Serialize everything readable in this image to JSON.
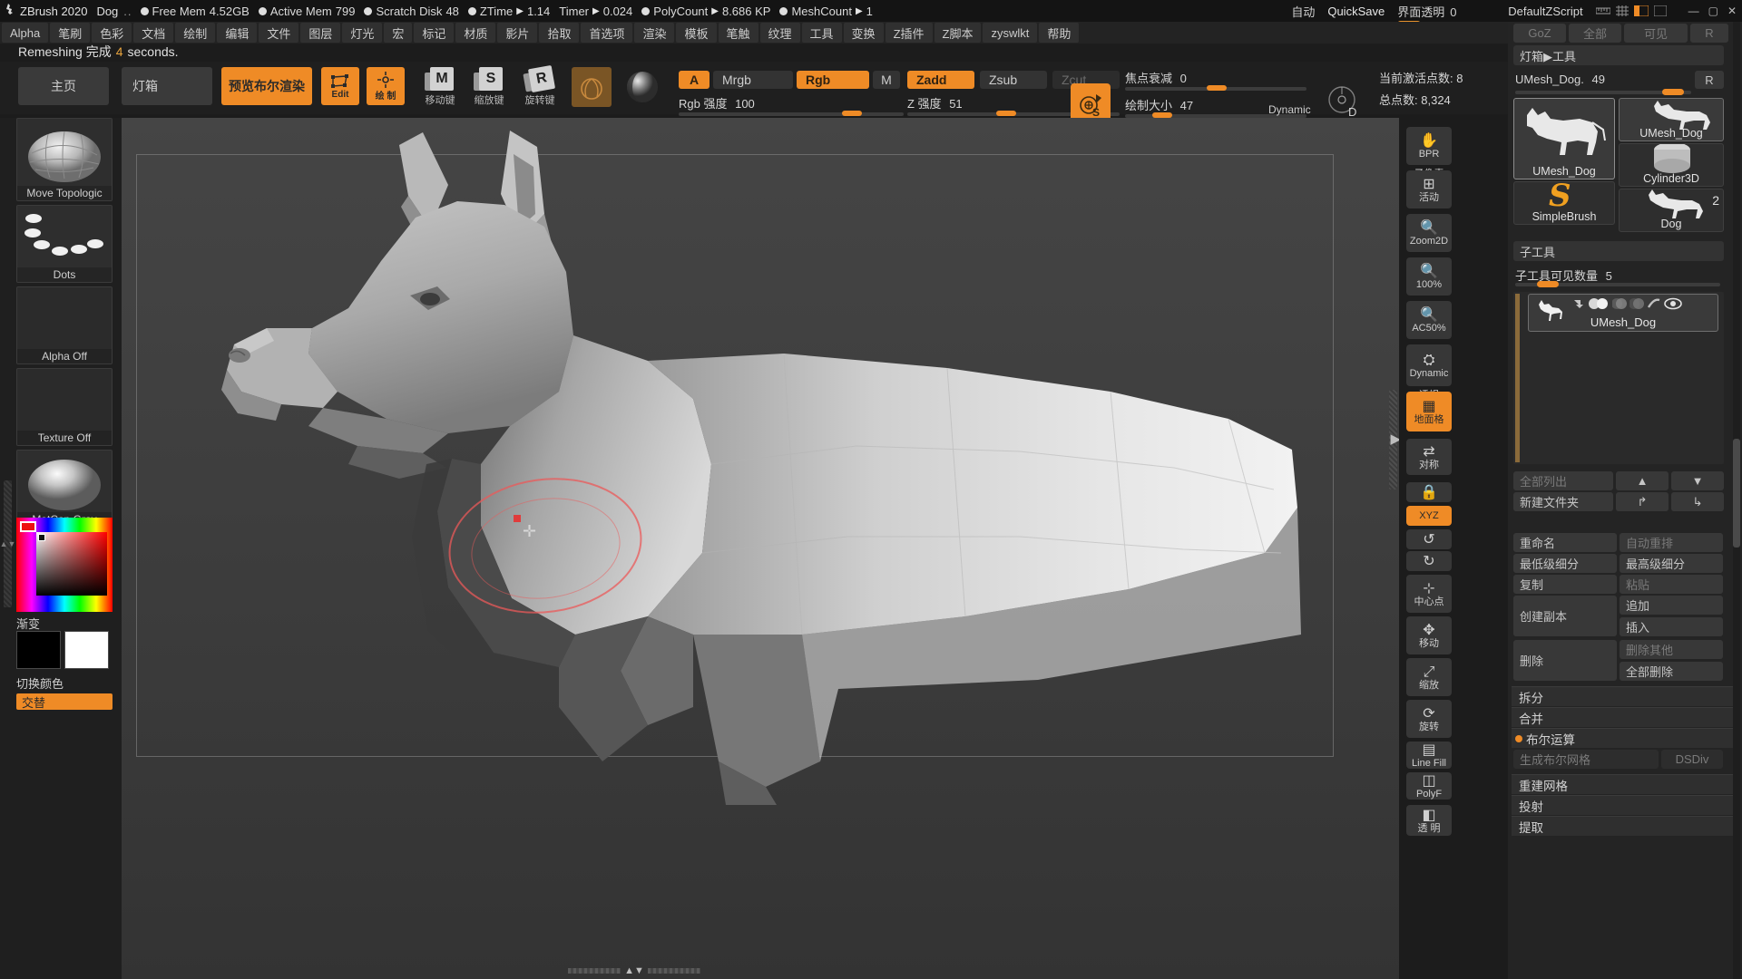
{
  "titlebar": {
    "logo_icon": "zbrush-logo-icon",
    "app_name": "ZBrush 2020",
    "document_name": "Dog",
    "ellipsis": "..",
    "stats": [
      {
        "label": "Free Mem",
        "value": "4.52GB"
      },
      {
        "label": "Active Mem",
        "value": "799"
      },
      {
        "label": "Scratch Disk",
        "value": "48"
      },
      {
        "label": "ZTime",
        "value": "1.14",
        "arrow": true
      },
      {
        "label": "Timer",
        "value": "0.024",
        "arrow": true
      },
      {
        "label": "PolyCount",
        "value": "8.686 KP",
        "arrow": true
      },
      {
        "label": "MeshCount",
        "value": "1",
        "arrow": true
      }
    ],
    "auto_label": "自动",
    "quicksave_label": "QuickSave",
    "transparency_label": "界面透明",
    "transparency_value": "0",
    "zscript_label": "DefaultZScript",
    "win_minimize": "—",
    "win_maximize": "▢",
    "win_close": "✕"
  },
  "menubar": {
    "items": [
      "Alpha",
      "笔刷",
      "色彩",
      "文档",
      "绘制",
      "编辑",
      "文件",
      "图层",
      "灯光",
      "宏",
      "标记",
      "材质",
      "影片",
      "拾取",
      "首选项",
      "渲染",
      "模板",
      "笔触",
      "纹理",
      "工具",
      "变换",
      "Z插件",
      "Z脚本",
      "zyswlkt",
      "帮助"
    ]
  },
  "status": {
    "prefix": "Remeshing 完成",
    "number": "4",
    "suffix": "seconds."
  },
  "toolbar": {
    "home_label": "主页",
    "lightbox_label": "灯箱",
    "boolean_preview_label": "预览布尔渲染",
    "edit_label": "Edit",
    "draw_label": "绘 制",
    "move_label": "移动键",
    "scale_label": "缩放键",
    "rotate_label": "旋转键",
    "move_badge": "M",
    "scale_badge": "S",
    "rotate_badge": "R",
    "brush_icon": "brush-thumbnail-icon",
    "material_icon": "material-sphere-icon",
    "mrgb_group": [
      {
        "label": "A",
        "state": "on"
      },
      {
        "label": "Mrgb",
        "state": "off"
      },
      {
        "label": "Rgb",
        "state": "on"
      },
      {
        "label": "M",
        "state": "off"
      },
      {
        "label": "Zadd",
        "state": "on"
      },
      {
        "label": "Zsub",
        "state": "off"
      },
      {
        "label": "Zcut",
        "state": "dim"
      }
    ],
    "rgb_intensity_label": "Rgb 强度",
    "rgb_intensity_value": "100",
    "z_intensity_label": "Z 强度",
    "z_intensity_value": "51",
    "focal_shift_label": "焦点衰减",
    "focal_shift_value": "0",
    "draw_size_label": "绘制大小",
    "draw_size_value": "47",
    "dynamic_label": "Dynamic",
    "dynamic_icon": "dynamic-brush-icon",
    "stroke_icon": "stroke-preview-icon",
    "d_label": "D",
    "active_points_label": "当前激活点数:",
    "active_points_value": "8",
    "total_points_label": "总点数:",
    "total_points_value": "8,324"
  },
  "sidebar": {
    "tiles": [
      {
        "name": "brush",
        "caption": "Move Topologic",
        "icon": "brush-move-topological-icon"
      },
      {
        "name": "stroke",
        "caption": "Dots",
        "icon": "stroke-dots-icon"
      },
      {
        "name": "alpha",
        "caption": "Alpha Off",
        "icon": "alpha-off-icon"
      },
      {
        "name": "texture",
        "caption": "Texture Off",
        "icon": "texture-off-icon"
      },
      {
        "name": "material",
        "caption": "MatCap Gray",
        "icon": "material-matcap-gray-icon"
      }
    ],
    "gradient_label": "渐变",
    "switch_color_label": "切换颜色",
    "alternate_label": "交替",
    "primary_color": "#000000",
    "secondary_color": "#ffffff"
  },
  "right_vbar": {
    "buttons": [
      {
        "label": "BPR",
        "sub": "子像素",
        "state": "off",
        "icon": "bpr-render-icon"
      },
      {
        "label": "活动",
        "sub": "",
        "state": "off",
        "icon": "scroll-active-icon"
      },
      {
        "label": "Zoom2D",
        "sub": "",
        "state": "off",
        "icon": "zoom-2d-icon"
      },
      {
        "label": "100%",
        "sub": "",
        "state": "off",
        "icon": "zoom-100-icon"
      },
      {
        "label": "AC50%",
        "sub": "",
        "state": "off",
        "icon": "zoom-ac50-icon"
      },
      {
        "label": "Dynamic",
        "sub": "透视",
        "state": "off",
        "icon": "perspective-icon"
      },
      {
        "label": "地面格",
        "sub": "",
        "state": "on",
        "icon": "floor-grid-icon"
      },
      {
        "label": "对称",
        "sub": "",
        "state": "off",
        "icon": "symmetry-icon"
      },
      {
        "label": "",
        "sub": "",
        "state": "off",
        "icon": "transp-lock-icon"
      },
      {
        "label": "XYZ",
        "sub": "",
        "state": "on",
        "icon": "xyz-axis-icon"
      },
      {
        "label": "",
        "sub": "",
        "state": "off",
        "icon": "rotate-ccw-icon"
      },
      {
        "label": "",
        "sub": "",
        "state": "off",
        "icon": "rotate-cw-icon"
      },
      {
        "label": "中心点",
        "sub": "",
        "state": "off",
        "icon": "frame-center-icon"
      },
      {
        "label": "移动",
        "sub": "",
        "state": "off",
        "icon": "move-hand-icon"
      },
      {
        "label": "缩放",
        "sub": "",
        "state": "off",
        "icon": "scale-icon"
      },
      {
        "label": "旋转",
        "sub": "",
        "state": "off",
        "icon": "rotate-icon"
      },
      {
        "label": "Line Fill",
        "sub": "",
        "state": "off",
        "icon": "line-fill-icon"
      },
      {
        "label": "PolyF",
        "sub": "",
        "state": "off",
        "icon": "polyframe-icon"
      },
      {
        "label": "透 明",
        "sub": "",
        "state": "off",
        "icon": "transparency-icon"
      }
    ]
  },
  "right_panel": {
    "top_row": [
      {
        "label": "GoZ"
      },
      {
        "label": "全部"
      },
      {
        "label": "可见"
      },
      {
        "label": "R"
      }
    ],
    "breadcrumb": "灯箱▶工具",
    "tool_name": "UMesh_Dog.",
    "tool_value": "49",
    "tool_r_btn": "R",
    "tool_tiles": [
      {
        "caption": "UMesh_Dog",
        "icon": "dog-mesh-thumbnail-icon",
        "selected": true
      },
      {
        "caption": "UMesh_Dog",
        "icon": "dog-mesh-thumbnail-icon",
        "selected": false
      },
      {
        "caption": "Cylinder3D",
        "icon": "cylinder-3d-icon",
        "selected": false
      },
      {
        "caption": "SimpleBrush",
        "icon": "simple-brush-icon",
        "selected": false
      },
      {
        "caption": "Dog",
        "icon": "dog-mesh-thumbnail-icon",
        "selected": false,
        "badge": "2"
      }
    ],
    "subtool": {
      "title": "子工具",
      "visible_count_label": "子工具可见数量",
      "visible_count_value": "5",
      "items": [
        {
          "name": "UMesh_Dog",
          "icon": "dog-subtool-icon"
        }
      ],
      "row_icons": [
        "merge-down-icon",
        "eye-half-icon",
        "polypaint-icon",
        "mask-icon",
        "smooth-icon",
        "visibility-eye-icon"
      ]
    },
    "list_buttons": [
      {
        "label": "全部列出",
        "dim": true
      },
      {
        "label": "▲",
        "dim": false
      },
      {
        "label": "▼",
        "dim": false
      },
      {
        "label": "新建文件夹",
        "dim": false
      },
      {
        "label": "↱",
        "dim": false
      },
      {
        "label": "↳",
        "dim": false
      }
    ],
    "ops": [
      {
        "left": "重命名",
        "right": "自动重排",
        "right_dim": true
      },
      {
        "left": "最低级细分",
        "right": "最高级细分",
        "right_dim": false
      },
      {
        "left": "复制",
        "right": "粘贴",
        "right_dim": true
      },
      {
        "left": "创建副本",
        "right": "追加",
        "right2": "插入",
        "right_dim": false
      },
      {
        "left": "删除",
        "right": "删除其他",
        "right2": "全部删除",
        "right_dim": true
      }
    ],
    "sections": [
      {
        "label": "拆分",
        "bullet": false
      },
      {
        "label": "合并",
        "bullet": false
      },
      {
        "label": "布尔运算",
        "bullet": true
      }
    ],
    "boolean_row": {
      "left": "生成布尔网格",
      "right": "DSDiv"
    },
    "sections2": [
      {
        "label": "重建网格",
        "bullet": false
      },
      {
        "label": "投射",
        "bullet": false
      },
      {
        "label": "提取",
        "bullet": false
      }
    ]
  },
  "colors": {
    "accent_orange": "#ef8b26",
    "panel_bg": "#242424",
    "canvas_bg": "#3f3f3f",
    "brush_ring": "#eb5a5a",
    "axis_green": "#21d321"
  }
}
